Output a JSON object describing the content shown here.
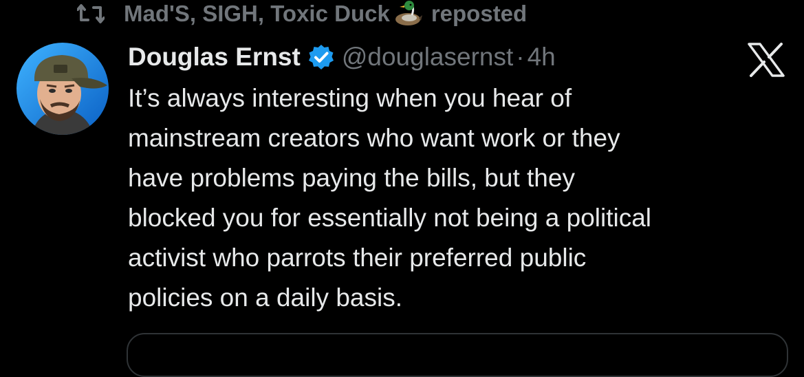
{
  "repost": {
    "names": "Mad'S, SIGH, Toxic Duck",
    "emoji": "duck-emoji",
    "suffix": "reposted"
  },
  "tweet": {
    "display_name": "Douglas Ernst",
    "handle": "@douglasernst",
    "separator": "·",
    "timestamp": "4h",
    "lines": [
      "It’s always interesting when you hear of",
      "mainstream creators who want work or they",
      "have problems paying the bills, but they",
      "blocked you for essentially not being a political",
      "activist who parrots their preferred public",
      "policies on a daily basis."
    ]
  },
  "icons": {
    "repost": "repost-icon",
    "verified": "verified-badge-icon",
    "platform": "x-logo-icon"
  },
  "colors": {
    "background": "#000000",
    "primary_text": "#e7e9ea",
    "secondary_text": "#71767b",
    "verified_blue": "#1d9bf0",
    "border": "#2f3336"
  }
}
